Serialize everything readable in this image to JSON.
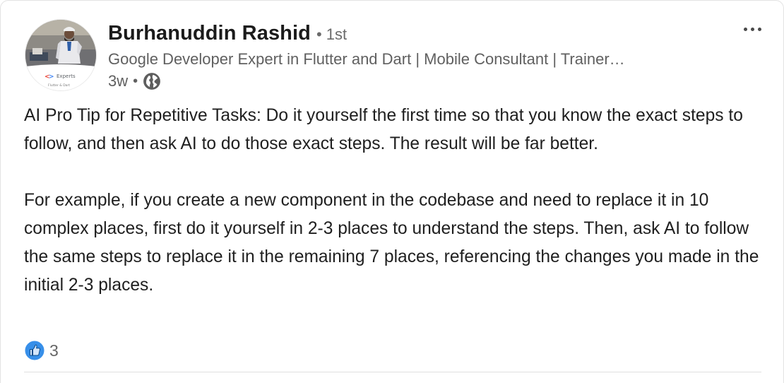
{
  "post": {
    "author": {
      "name": "Burhanuddin Rashid",
      "degree": "• 1st",
      "headline": "Google Developer Expert in Flutter and Dart | Mobile Consultant | Trainer…",
      "avatar_badge_title": "Experts",
      "avatar_badge_subtitle": "Flutter & Dart"
    },
    "timestamp": "3w",
    "meta_separator": "•",
    "visibility_icon": "globe-icon",
    "more_menu_icon": "more-horizontal-icon",
    "body_paragraphs": [
      "AI Pro Tip for Repetitive Tasks: Do it yourself the first time so that you know the exact steps to follow, and then ask AI to do those exact steps. The result will be far better.",
      "For example, if you create a new component in the codebase and need to replace it in 10 complex places, first do it yourself in 2-3 places to understand the steps. Then, ask AI to follow the same steps to replace it in the remaining 7 places, referencing the changes you made in the initial 2-3 places."
    ],
    "reactions": {
      "icon": "like-icon",
      "count": "3"
    }
  },
  "colors": {
    "like_blue": "#378fe9",
    "text_primary": "#1f1f1f",
    "text_secondary": "#606060",
    "divider": "#e0e0e0"
  }
}
